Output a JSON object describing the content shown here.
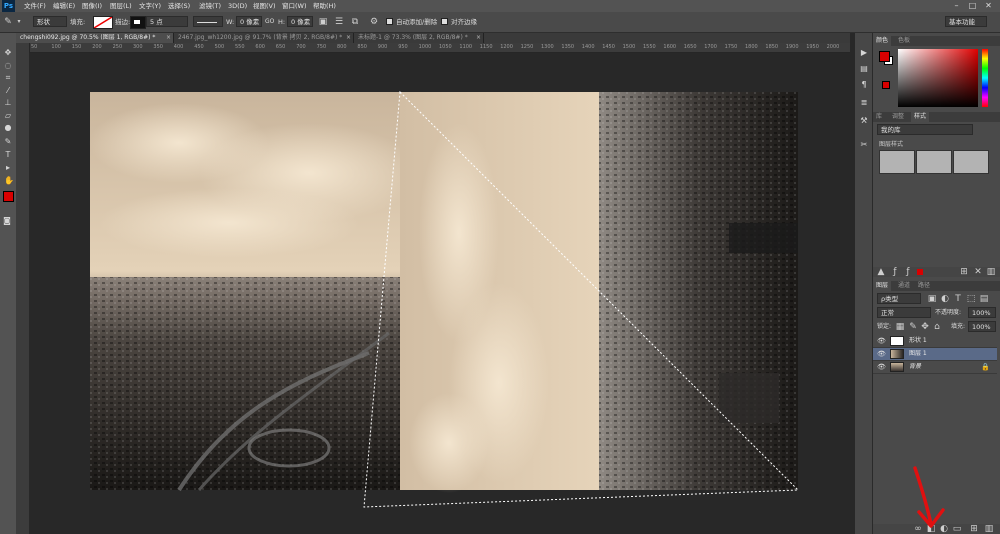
{
  "app": {
    "logo": "Ps"
  },
  "menu": [
    "文件(F)",
    "编辑(E)",
    "图像(I)",
    "图层(L)",
    "文字(Y)",
    "选择(S)",
    "滤镜(T)",
    "3D(D)",
    "视图(V)",
    "窗口(W)",
    "帮助(H)"
  ],
  "window_controls": {
    "minimize": "–",
    "maximize": "□",
    "close": "✕"
  },
  "options": {
    "mode_value": "形状",
    "fill_label": "填充:",
    "stroke_label": "描边:",
    "stroke_width": "5 点",
    "w_label": "W:",
    "w_value": "0 像素",
    "link_label": "GO",
    "h_label": "H:",
    "h_value": "0 像素",
    "auto_add_delete": "自动添加/删除",
    "align_edges": "对齐边缘",
    "workspace": "基本功能"
  },
  "tabs": [
    {
      "label": "chengshi092.jpg @ 70.5% (图层 1, RGB/8#) *",
      "active": true
    },
    {
      "label": "2467.jpg_wh1200.jpg @ 91.7% (背景 拷贝 2, RGB/8#) *",
      "active": false
    },
    {
      "label": "未标题-1 @ 73.3% (图层 2, RGB/8#) *",
      "active": false
    }
  ],
  "ruler_ticks": [
    "50",
    "100",
    "150",
    "200",
    "250",
    "300",
    "350",
    "400",
    "450",
    "500",
    "550",
    "600",
    "650",
    "700",
    "750",
    "800",
    "850",
    "900",
    "950",
    "1000",
    "1050",
    "1100",
    "1150",
    "1200",
    "1250",
    "1300",
    "1350",
    "1400",
    "1450",
    "1500",
    "1550",
    "1600",
    "1650",
    "1700",
    "1750",
    "1800",
    "1850",
    "1900",
    "1950",
    "2000"
  ],
  "color_panel": {
    "tabs": [
      "颜色",
      "色板"
    ]
  },
  "styles_panel": {
    "tabs": [
      "库",
      "调整",
      "样式"
    ],
    "library": "我的库",
    "group": "图层样式"
  },
  "layers_panel": {
    "tabs": [
      "图层",
      "通道",
      "路径"
    ],
    "kind": "ρ类型",
    "blend_mode": "正常",
    "opacity_label": "不透明度:",
    "opacity": "100%",
    "lock_label": "锁定:",
    "fill_label": "填充:",
    "fill": "100%",
    "layers": [
      {
        "name": "形状 1",
        "selected": false
      },
      {
        "name": "图层 1",
        "selected": true
      },
      {
        "name": "背景",
        "selected": false
      }
    ]
  },
  "colors": {
    "foreground": "#d80000",
    "background": "#ffffff",
    "annotation_arrow": "#e01010"
  }
}
